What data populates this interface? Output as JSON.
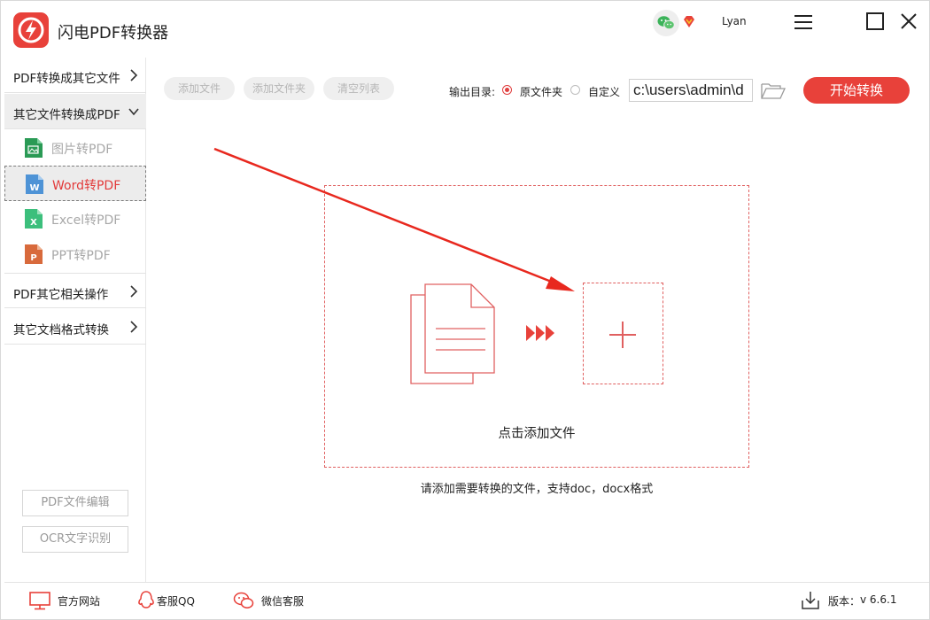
{
  "app": {
    "title": "闪电PDF转换器",
    "username": "Lyan"
  },
  "sidebar": {
    "groups": [
      {
        "label": "PDF转换成其它文件"
      },
      {
        "label": "其它文件转换成PDF"
      },
      {
        "label": "PDF其它相关操作"
      },
      {
        "label": "其它文档格式转换"
      }
    ],
    "subitems": [
      {
        "label": "图片转PDF",
        "icon_letter": "",
        "color": "#2a9a55"
      },
      {
        "label": "Word转PDF",
        "icon_letter": "W",
        "color": "#4e93d6"
      },
      {
        "label": "Excel转PDF",
        "icon_letter": "X",
        "color": "#3cbf7c"
      },
      {
        "label": "PPT转PDF",
        "icon_letter": "P",
        "color": "#d86a3c"
      }
    ],
    "buttons": {
      "pdf_edit": "PDF文件编辑",
      "ocr": "OCR文字识别"
    }
  },
  "toolbar": {
    "add_file": "添加文件",
    "add_folder": "添加文件夹",
    "clear_list": "清空列表",
    "output_label": "输出目录:",
    "radio_original": "原文件夹",
    "radio_custom": "自定义",
    "path_value": "c:\\users\\admin\\d",
    "start_button": "开始转换"
  },
  "dropzone": {
    "label": "点击添加文件",
    "hint": "请添加需要转换的文件，支持doc，docx格式"
  },
  "footer": {
    "website": "官方网站",
    "qq": "客服QQ",
    "wechat": "微信客服",
    "version_label": "版本：",
    "version": "v 6.6.1"
  },
  "colors": {
    "accent": "#e8413a",
    "dashed": "#e06060"
  }
}
